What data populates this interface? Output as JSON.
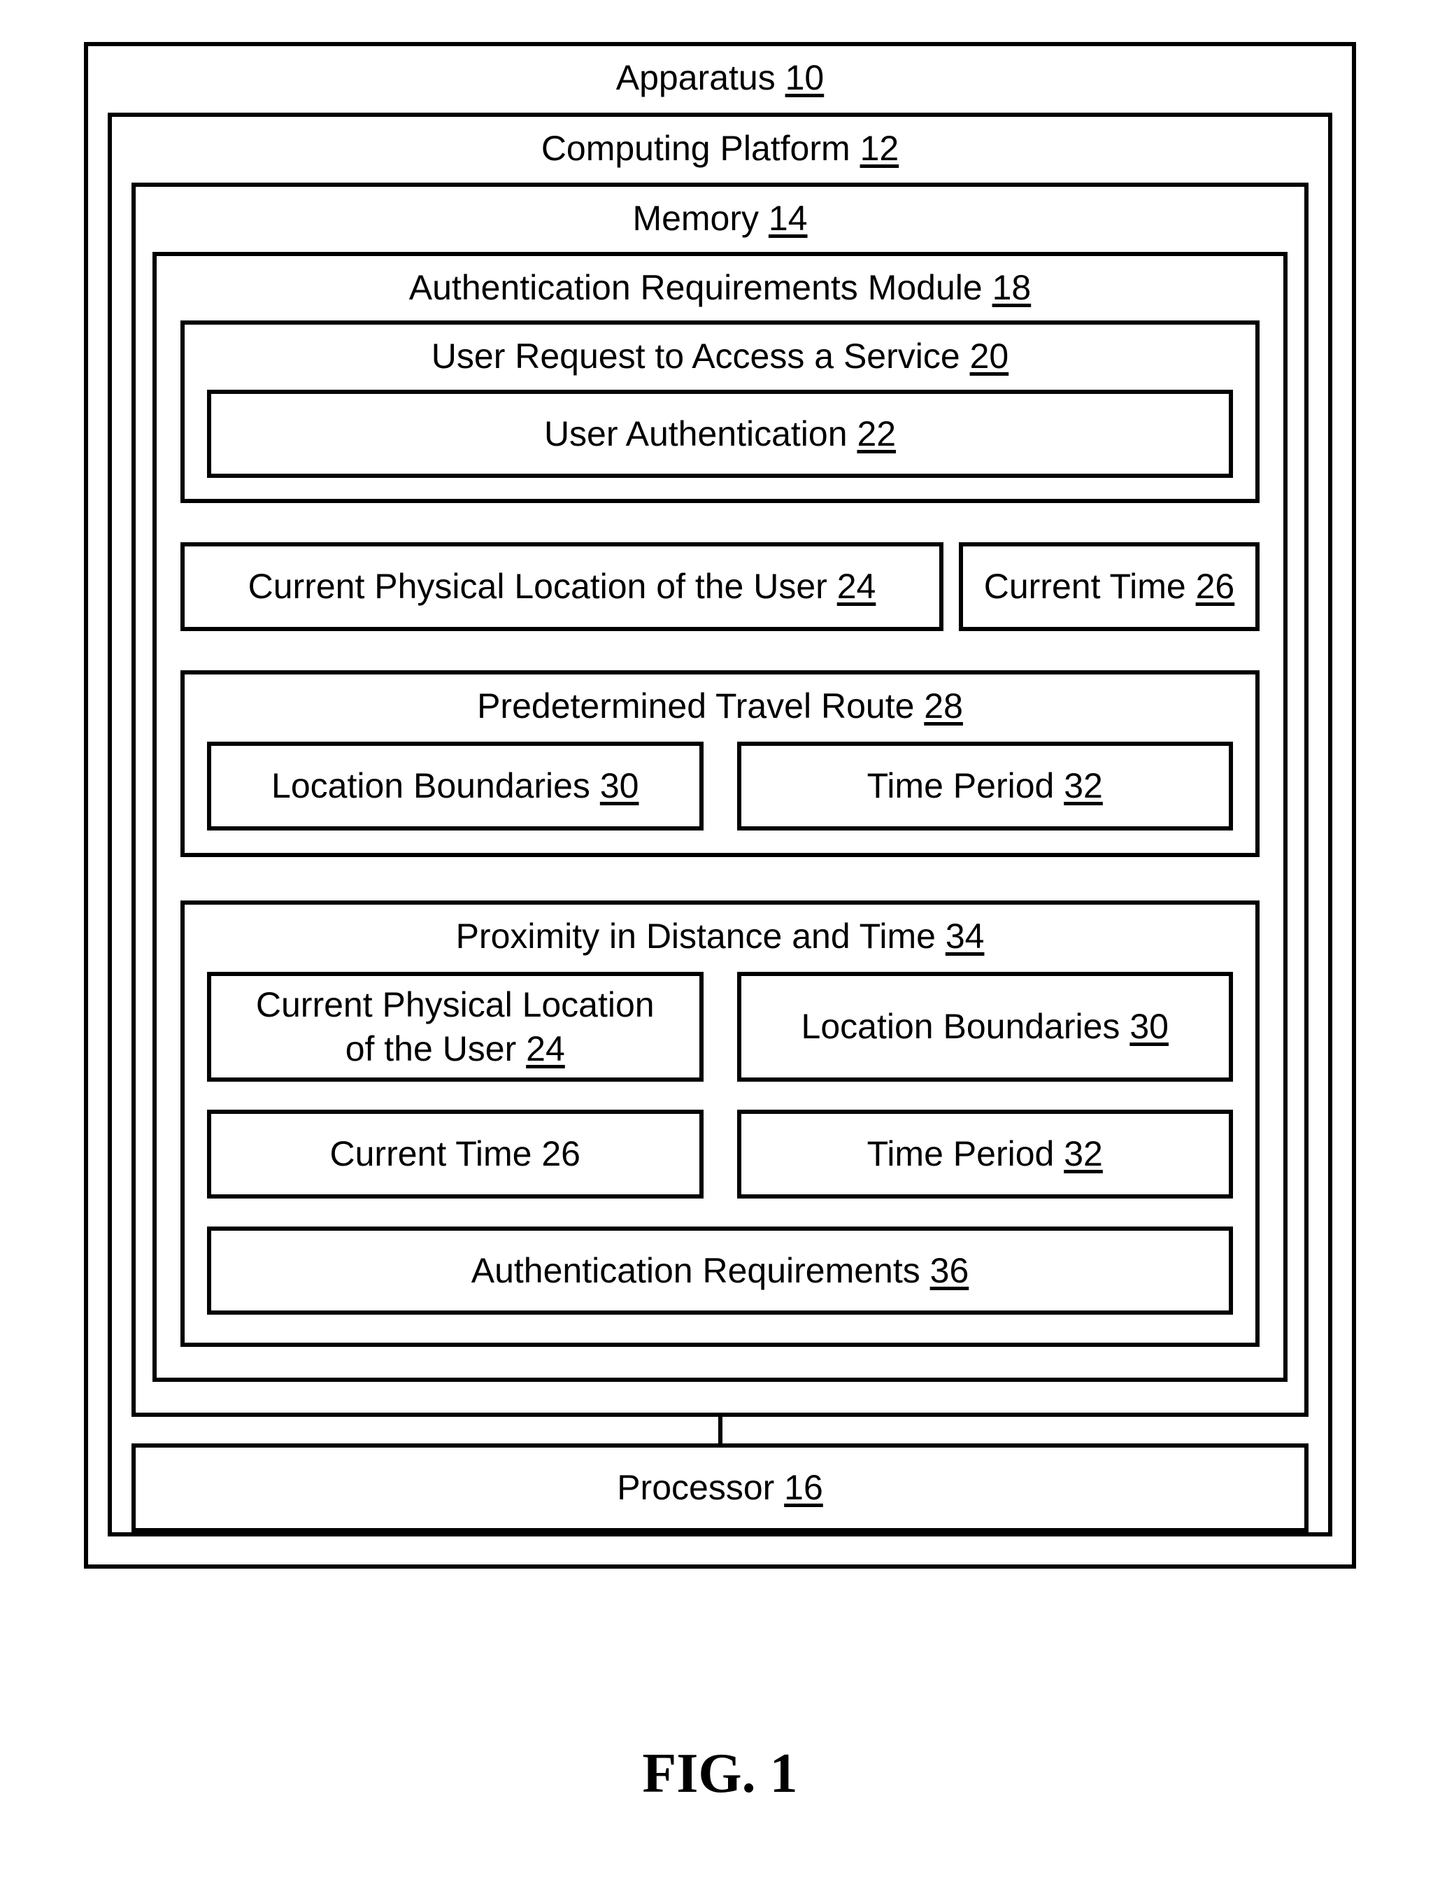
{
  "apparatus": {
    "label": "Apparatus ",
    "num": "10"
  },
  "computing_platform": {
    "label": "Computing Platform ",
    "num": "12"
  },
  "memory": {
    "label": "Memory ",
    "num": "14"
  },
  "auth_module": {
    "label": "Authentication Requirements Module ",
    "num": "18"
  },
  "user_request": {
    "label": "User Request to Access a Service ",
    "num": "20"
  },
  "user_auth": {
    "label": "User Authentication ",
    "num": "22"
  },
  "current_location": {
    "label": "Current Physical Location of the User ",
    "num": "24"
  },
  "current_time": {
    "label": "Current Time ",
    "num": "26"
  },
  "travel_route": {
    "label": "Predetermined Travel Route ",
    "num": "28"
  },
  "location_boundaries": {
    "label": "Location Boundaries ",
    "num": "30"
  },
  "time_period": {
    "label": "Time Period ",
    "num": "32"
  },
  "proximity": {
    "label": "Proximity in Distance and Time ",
    "num": "34"
  },
  "prox_location_line1": "Current Physical Location",
  "prox_location_line2_prefix": "of the User ",
  "prox_location_num": "24",
  "prox_location_boundaries": {
    "label": "Location Boundaries ",
    "num": "30"
  },
  "prox_current_time": {
    "label": "Current Time 26"
  },
  "prox_time_period": {
    "label": "Time Period ",
    "num": "32"
  },
  "auth_requirements": {
    "label": "Authentication Requirements ",
    "num": "36"
  },
  "processor": {
    "label": "Processor ",
    "num": "16"
  },
  "figure_label": "FIG. 1"
}
